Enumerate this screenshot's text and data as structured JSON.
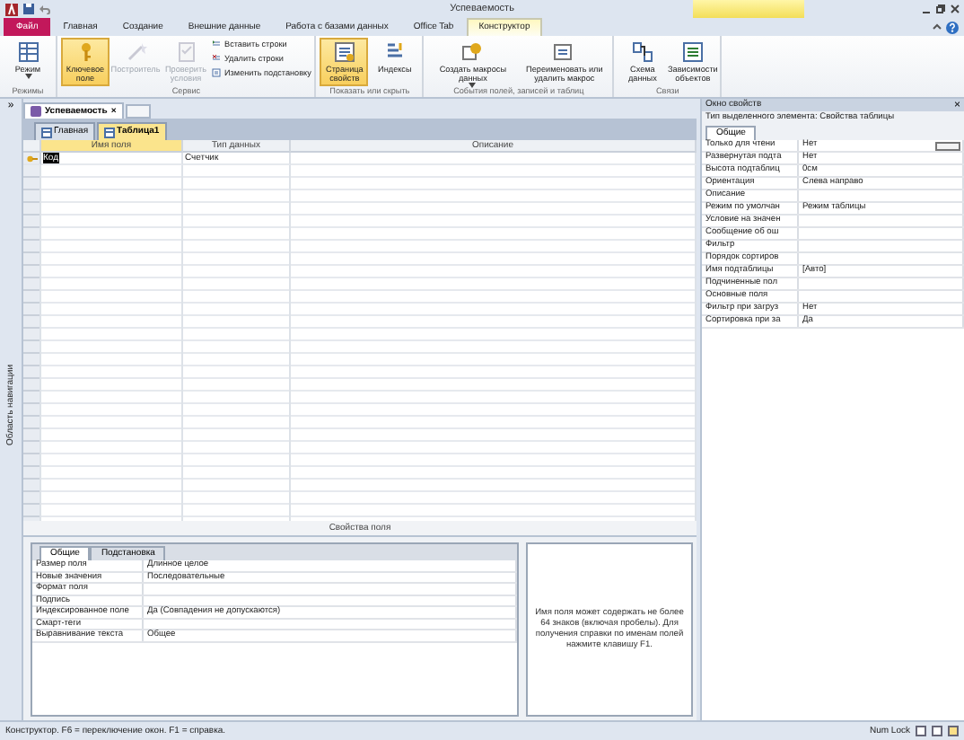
{
  "window": {
    "title": "Успеваемость"
  },
  "ribbon": {
    "tabs": [
      {
        "label": "Файл",
        "kind": "file",
        "selected": false
      },
      {
        "label": "Главная",
        "kind": "tab",
        "selected": false
      },
      {
        "label": "Создание",
        "kind": "tab",
        "selected": false
      },
      {
        "label": "Внешние данные",
        "kind": "tab",
        "selected": false
      },
      {
        "label": "Работа с базами данных",
        "kind": "tab",
        "selected": false
      },
      {
        "label": "Office Tab",
        "kind": "tab",
        "selected": false
      },
      {
        "label": "Конструктор",
        "kind": "contextual",
        "selected": true
      }
    ],
    "groups": [
      {
        "label": "Режимы",
        "buttons": [
          {
            "label": "Режим",
            "kind": "large",
            "selected": false,
            "disabled": false,
            "dropdown": true
          }
        ]
      },
      {
        "label": "Сервис",
        "buttons": [
          {
            "label": "Ключевое поле",
            "kind": "large",
            "selected": true,
            "disabled": false
          },
          {
            "label": "Построитель",
            "kind": "large",
            "selected": false,
            "disabled": true
          },
          {
            "label": "Проверить условия",
            "kind": "large",
            "selected": false,
            "disabled": true
          },
          {
            "label": "Вставить строки",
            "kind": "small",
            "selected": false,
            "disabled": false
          },
          {
            "label": "Удалить строки",
            "kind": "small",
            "selected": false,
            "disabled": false
          },
          {
            "label": "Изменить подстановку",
            "kind": "small",
            "selected": false,
            "disabled": false
          }
        ]
      },
      {
        "label": "Показать или скрыть",
        "buttons": [
          {
            "label": "Страница свойств",
            "kind": "large",
            "selected": true,
            "disabled": false
          },
          {
            "label": "Индексы",
            "kind": "large",
            "selected": false,
            "disabled": false
          }
        ]
      },
      {
        "label": "События полей, записей и таблиц",
        "buttons": [
          {
            "label": "Создать макросы данных",
            "kind": "large",
            "selected": false,
            "disabled": false,
            "dropdown": true
          },
          {
            "label": "Переименовать или удалить макрос",
            "kind": "large",
            "selected": false,
            "disabled": false
          }
        ]
      },
      {
        "label": "Связи",
        "buttons": [
          {
            "label": "Схема данных",
            "kind": "large",
            "selected": false,
            "disabled": false
          },
          {
            "label": "Зависимости объектов",
            "kind": "large",
            "selected": false,
            "disabled": false
          }
        ]
      }
    ]
  },
  "navigation_pane": {
    "label": "Область навигации",
    "toggle": "»"
  },
  "document_tabs": [
    {
      "label": "Успеваемость",
      "selected": true,
      "close": "×"
    }
  ],
  "object_tabs": [
    {
      "label": "Главная",
      "selected": false
    },
    {
      "label": "Таблица1",
      "selected": true
    }
  ],
  "design_grid": {
    "columns": [
      "Имя поля",
      "Тип данных",
      "Описание"
    ],
    "rows": [
      {
        "field_name": "Код",
        "data_type": "Счетчик",
        "primary_key": true,
        "selected": true
      }
    ]
  },
  "field_properties": {
    "title": "Свойства поля",
    "tabs": [
      {
        "label": "Общие",
        "selected": true
      },
      {
        "label": "Подстановка",
        "selected": false
      }
    ],
    "rows": [
      {
        "name": "Размер поля",
        "value": "Длинное целое"
      },
      {
        "name": "Новые значения",
        "value": "Последовательные"
      },
      {
        "name": "Формат поля"
      },
      {
        "name": "Подпись"
      },
      {
        "name": "Индексированное поле",
        "value": "Да (Совпадения не допускаются)"
      },
      {
        "name": "Смарт-теги"
      },
      {
        "name": "Выравнивание текста",
        "value": "Общее"
      }
    ],
    "help": "Имя поля может содержать не более 64 знаков (включая пробелы). Для получения справки по именам полей нажмите клавишу F1."
  },
  "property_sheet": {
    "title": "Окно свойств",
    "close": "×",
    "subtitle": "Тип выделенного элемента:  Свойства таблицы",
    "tabs": [
      {
        "label": "Общие",
        "selected": true
      }
    ],
    "rows": [
      {
        "name": "Только для чтени",
        "value": "Нет",
        "focused": true
      },
      {
        "name": "Развернутая подта",
        "value": "Нет",
        "focused": false
      },
      {
        "name": "Высота подтаблиц",
        "value": "0см",
        "focused": false
      },
      {
        "name": "Ориентация",
        "value": "Слева направо",
        "focused": false
      },
      {
        "name": "Описание",
        "focused": false
      },
      {
        "name": "Режим по умолчан",
        "value": "Режим таблицы",
        "focused": false
      },
      {
        "name": "Условие на значен",
        "focused": false
      },
      {
        "name": "Сообщение об ош",
        "focused": false
      },
      {
        "name": "Фильтр",
        "focused": false
      },
      {
        "name": "Порядок сортиров",
        "focused": false
      },
      {
        "name": "Имя подтаблицы",
        "value": "[Авто]",
        "focused": false
      },
      {
        "name": "Подчиненные пол",
        "focused": false
      },
      {
        "name": "Основные поля",
        "focused": false
      },
      {
        "name": "Фильтр при загруз",
        "value": "Нет",
        "focused": false
      },
      {
        "name": "Сортировка при за",
        "value": "Да",
        "focused": false
      }
    ]
  },
  "status_bar": {
    "text": "Конструктор.  F6 = переключение окон.  F1 = справка.",
    "indicator": "Num Lock"
  }
}
